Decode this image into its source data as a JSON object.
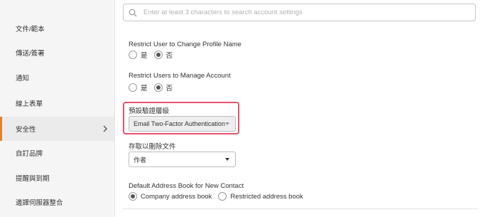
{
  "sidebar": {
    "items": [
      {
        "label": "文件/範本"
      },
      {
        "label": "傳送/簽署"
      },
      {
        "label": "通知"
      },
      {
        "label": "線上表單"
      },
      {
        "label": "安全性"
      },
      {
        "label": "自訂品牌"
      },
      {
        "label": "提醒與到期"
      },
      {
        "label": "邊譯伺服器整合"
      }
    ],
    "active_index": 4
  },
  "search": {
    "placeholder": "Enter at least 3 characters to search account settings",
    "value": ""
  },
  "settings": {
    "restrict_profile_name": {
      "label": "Restrict User to Change Profile Name",
      "yes": "是",
      "no": "否",
      "selected": "no"
    },
    "restrict_manage_account": {
      "label": "Restrict Users to Manage Account",
      "yes": "是",
      "no": "否",
      "selected": "no"
    },
    "default_auth_level": {
      "label": "預設驗證層級",
      "value": "Email Two-Factor Authentication"
    },
    "access_delete_docs": {
      "label": "存取以刪除文件",
      "value": "作者"
    },
    "default_address_book": {
      "label": "Default Address Book for New Contact",
      "option_company": "Company address book",
      "option_restricted": "Restricted address book",
      "selected": "company"
    }
  },
  "colors": {
    "accent": "#f07d1e",
    "highlight": "#e8526a",
    "sidebar_bg": "#f5f5f5"
  }
}
